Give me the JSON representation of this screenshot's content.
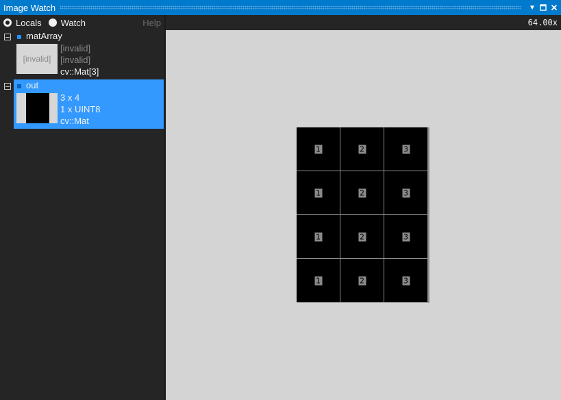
{
  "window": {
    "title": "Image Watch"
  },
  "toolbar": {
    "mode_locals": "Locals",
    "mode_watch": "Watch",
    "selected_mode": "Locals",
    "help": "Help",
    "zoom": "64.00x"
  },
  "variables": [
    {
      "name": "matArray",
      "thumbnail_text": "[invalid]",
      "lines": [
        "[invalid]",
        "[invalid]",
        "cv::Mat[3]"
      ],
      "selected": false
    },
    {
      "name": "out",
      "thumbnail_text": "",
      "lines": [
        "3 x 4",
        "1 x UINT8",
        "cv::Mat"
      ],
      "selected": true
    }
  ],
  "image": {
    "columns": 3,
    "rows": 4,
    "pixel_values": [
      [
        "1",
        "2",
        "3"
      ],
      [
        "1",
        "2",
        "3"
      ],
      [
        "1",
        "2",
        "3"
      ],
      [
        "1",
        "2",
        "3"
      ]
    ]
  },
  "colors": {
    "accent": "#007acc",
    "selection": "#3399ff",
    "canvas_background": "#d4d4d4"
  }
}
